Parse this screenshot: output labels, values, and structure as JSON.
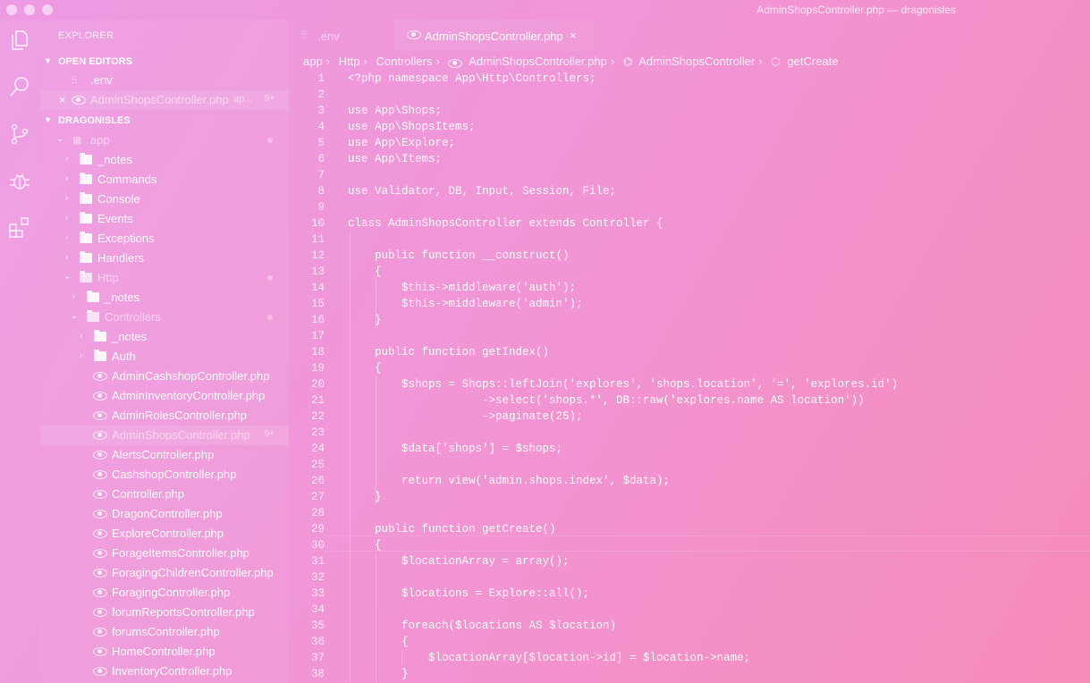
{
  "window": {
    "title": "AdminShopsController.php — dragonisles"
  },
  "activity_bar": {
    "icons": [
      "files-icon",
      "search-icon",
      "source-control-icon",
      "debug-icon",
      "extensions-icon"
    ]
  },
  "sidebar": {
    "header": "EXPLORER",
    "open_editors_label": "OPEN EDITORS",
    "open_editors": [
      {
        "label": ".env"
      },
      {
        "label": "AdminShopsController.php",
        "hint": "ap...",
        "badge": "9+"
      }
    ],
    "project_label": "DRAGONISLES",
    "tree": [
      {
        "label": "app"
      },
      {
        "label": "_notes"
      },
      {
        "label": "Commands"
      },
      {
        "label": "Console"
      },
      {
        "label": "Events"
      },
      {
        "label": "Exceptions"
      },
      {
        "label": "Handlers"
      },
      {
        "label": "Http"
      },
      {
        "label": "_notes"
      },
      {
        "label": "Controllers"
      },
      {
        "label": "_notes"
      },
      {
        "label": "Auth"
      },
      {
        "label": "AdminCashshopController.php"
      },
      {
        "label": "AdminInventoryController.php"
      },
      {
        "label": "AdminRolesController.php"
      },
      {
        "label": "AdminShopsController.php",
        "badge": "9+"
      },
      {
        "label": "AlertsController.php"
      },
      {
        "label": "CashshopController.php"
      },
      {
        "label": "Controller.php"
      },
      {
        "label": "DragonController.php"
      },
      {
        "label": "ExploreController.php"
      },
      {
        "label": "ForageItemsController.php"
      },
      {
        "label": "ForagingChildrenController.php"
      },
      {
        "label": "ForagingController.php"
      },
      {
        "label": "forumReportsController.php"
      },
      {
        "label": "forumsController.php"
      },
      {
        "label": "HomeController.php"
      },
      {
        "label": "InventoryController.php"
      }
    ]
  },
  "tabs": [
    {
      "label": ".env",
      "icon": "settings-file-icon"
    },
    {
      "label": "AdminShopsController.php",
      "icon": "php-file-icon",
      "close": "×"
    }
  ],
  "breadcrumb": [
    "app",
    "Http",
    "Controllers",
    "AdminShopsController.php",
    "AdminShopsController",
    "getCreate"
  ],
  "editor": {
    "current_line": 30,
    "lines": [
      "<?php namespace App\\Http\\Controllers;",
      "",
      "use App\\Shops;",
      "use App\\ShopsItems;",
      "use App\\Explore;",
      "use App\\Items;",
      "",
      "use Validator, DB, Input, Session, File;",
      "",
      "class AdminShopsController extends Controller {",
      "",
      "    public function __construct()",
      "    {",
      "        $this->middleware('auth');",
      "        $this->middleware('admin');",
      "    }",
      "",
      "    public function getIndex()",
      "    {",
      "        $shops = Shops::leftJoin('explores', 'shops.location', '=', 'explores.id')",
      "                    ->select('shops.*', DB::raw('explores.name AS location'))",
      "                    ->paginate(25);",
      "",
      "        $data['shops'] = $shops;",
      "",
      "        return view('admin.shops.index', $data);",
      "    }",
      "",
      "    public function getCreate()",
      "    {",
      "        $locationArray = array();",
      "",
      "        $locations = Explore::all();",
      "",
      "        foreach($locations AS $location)",
      "        {",
      "            $locationArray[$location->id] = $location->name;",
      "        }"
    ]
  }
}
